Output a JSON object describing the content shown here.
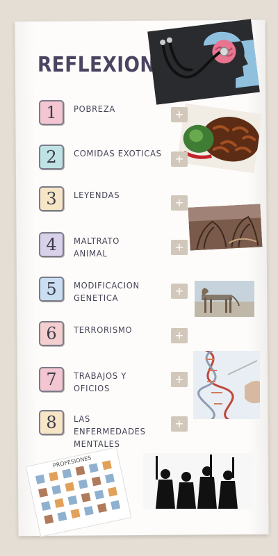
{
  "title": "REFLEXION",
  "items": [
    {
      "num": "1",
      "label": "POBREZA",
      "color": "#f4c6d2"
    },
    {
      "num": "2",
      "label": "COMIDAS EXOTICAS",
      "color": "#bfe3e4"
    },
    {
      "num": "3",
      "label": "LEYENDAS",
      "color": "#f6e6c6"
    },
    {
      "num": "4",
      "label": "MALTRATO ANIMAL",
      "color": "#d9d1ea"
    },
    {
      "num": "5",
      "label": "MODIFICACION GENETICA",
      "color": "#c9def0"
    },
    {
      "num": "6",
      "label": "TERRORISMO",
      "color": "#f3cfd0"
    },
    {
      "num": "7",
      "label": "TRABAJOS Y OFICIOS",
      "color": "#f4c6d2"
    },
    {
      "num": "8",
      "label": "LAS ENFERMEDADES MENTALES",
      "color": "#f6e6c6"
    }
  ],
  "plus_symbol": "+",
  "images": {
    "brain_stethoscope": "brain-stethoscope-photo",
    "insects_food": "fried-insects-photo",
    "roots_creature": "roots-creature-photo",
    "dog": "thin-dog-photo",
    "dna": "dna-photo",
    "professions_sheet": "professions-worksheet",
    "professions_sheet_title": "PROFESIONES",
    "silhouettes": "armed-silhouettes-photo"
  }
}
